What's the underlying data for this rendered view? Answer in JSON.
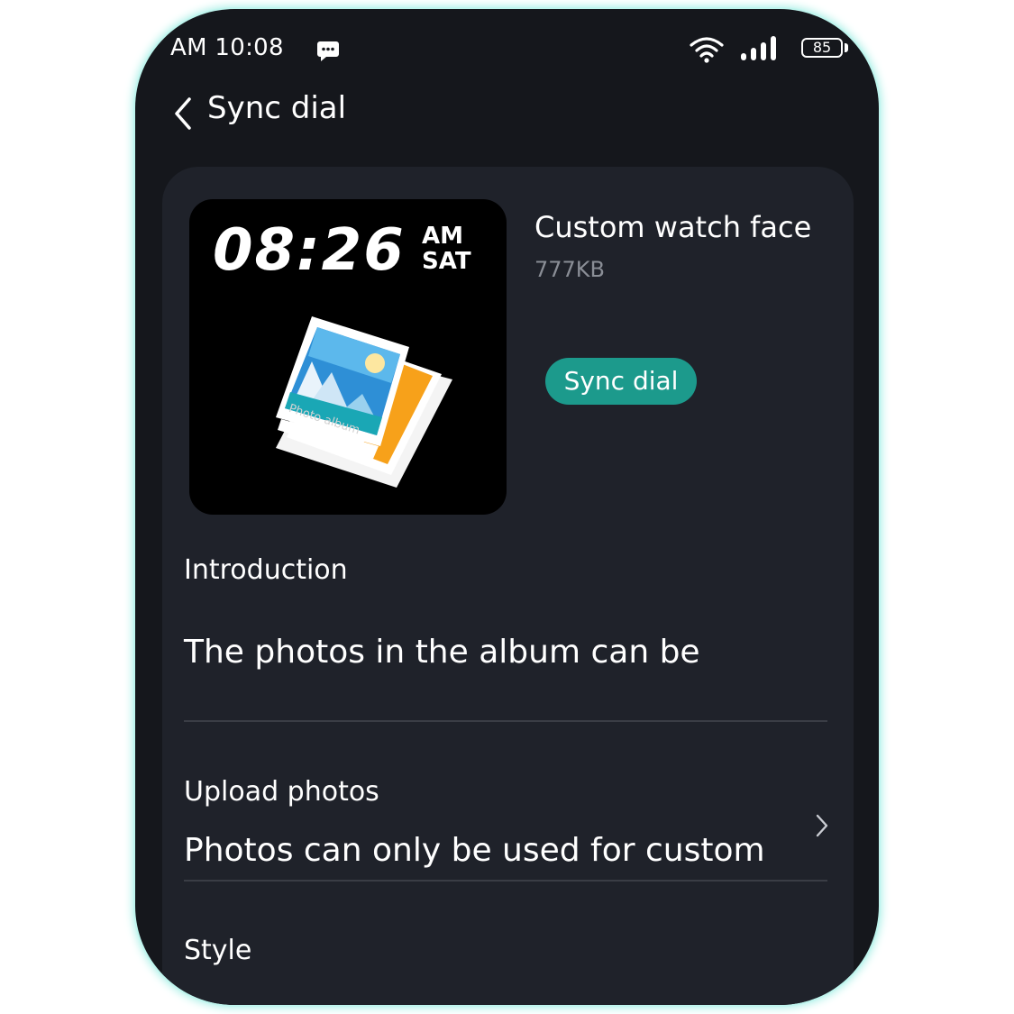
{
  "status_bar": {
    "time": "AM 10:08",
    "battery_level": "85",
    "icons": [
      "message-icon",
      "wifi-icon",
      "signal-icon",
      "battery-icon"
    ]
  },
  "header": {
    "back_icon": "chevron-left-icon",
    "title": "Sync dial"
  },
  "watch_face": {
    "time": "08:26",
    "ampm": "AM",
    "day": "SAT",
    "art_label": "Photo album"
  },
  "dial_info": {
    "name": "Custom watch face",
    "size": "777KB",
    "sync_button": "Sync dial"
  },
  "introduction": {
    "heading": "Introduction",
    "text": "The photos in the album can be"
  },
  "upload": {
    "title": "Upload photos",
    "description": "Photos can only be used for custom",
    "chevron_icon": "chevron-right-icon"
  },
  "style_section": {
    "heading": "Style"
  },
  "colors": {
    "background": "#15171c",
    "card": "#1f222a",
    "accent": "#1c9a8c",
    "glow": "#bff5ee"
  }
}
